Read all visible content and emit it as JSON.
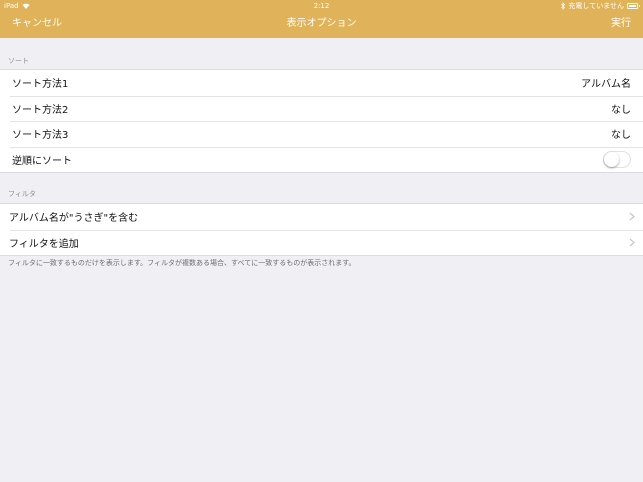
{
  "status_bar": {
    "device": "iPad",
    "wifi_icon": "wifi-icon",
    "time": "2:12",
    "bluetooth_icon": "bluetooth-icon",
    "charging_text": "充電していません",
    "battery_icon": "battery-icon"
  },
  "nav": {
    "cancel": "キャンセル",
    "title": "表示オプション",
    "run": "実行",
    "bar_color": "#e0b35a"
  },
  "sort": {
    "header": "ソート",
    "rows": [
      {
        "label": "ソート方法1",
        "value": "アルバム名"
      },
      {
        "label": "ソート方法2",
        "value": "なし"
      },
      {
        "label": "ソート方法3",
        "value": "なし"
      }
    ],
    "reverse": {
      "label": "逆順にソート",
      "enabled": false
    }
  },
  "filter": {
    "header": "フィルタ",
    "rows": [
      {
        "label": "アルバム名が\"うさぎ\"を含む",
        "icon": "chevron-right-icon"
      },
      {
        "label": "フィルタを追加",
        "icon": "chevron-right-icon"
      }
    ],
    "note": "フィルタに一致するものだけを表示します。フィルタが複数ある場合、すべてに一致するものが表示されます。"
  }
}
